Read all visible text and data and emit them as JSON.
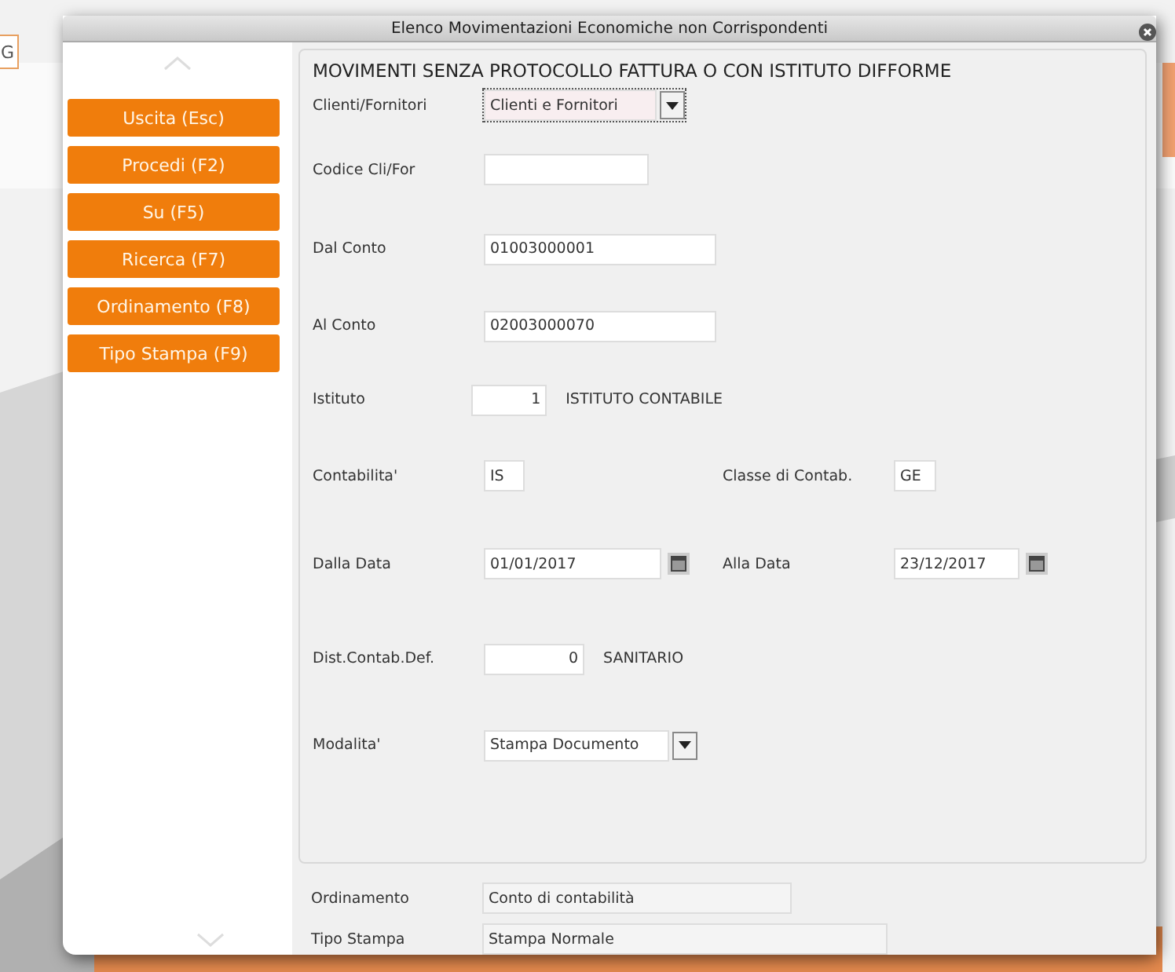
{
  "background_page": {
    "button_text": "G"
  },
  "window": {
    "title": "Elenco Movimentazioni Economiche non Corrispondenti"
  },
  "sidebar": {
    "buttons": [
      {
        "label": "Uscita (Esc)"
      },
      {
        "label": "Procedi (F2)"
      },
      {
        "label": "Su (F5)"
      },
      {
        "label": "Ricerca (F7)"
      },
      {
        "label": "Ordinamento (F8)"
      },
      {
        "label": "Tipo Stampa (F9)"
      }
    ]
  },
  "form": {
    "title": "MOVIMENTI SENZA PROTOCOLLO FATTURA O CON ISTITUTO DIFFORME",
    "rows": [
      {
        "fields": [
          {
            "label": "Clienti/Fornitori",
            "kind": "select",
            "value": "Clienti e Fornitori",
            "focused": true
          }
        ]
      },
      {
        "fields": [
          {
            "label": "Codice Cli/For",
            "kind": "text"
          }
        ]
      },
      {
        "fields": [
          {
            "label": "Dal Conto",
            "kind": "text",
            "value": "01003000001"
          }
        ]
      },
      {
        "fields": [
          {
            "label": "Al Conto",
            "kind": "text",
            "value": "02003000070"
          }
        ]
      },
      {
        "fields": [
          {
            "label": "Istituto",
            "kind": "number",
            "value": "1",
            "note": "ISTITUTO CONTABILE"
          }
        ]
      },
      {
        "fields": [
          {
            "label": "Contabilita'",
            "kind": "text",
            "value": "IS"
          },
          {
            "label": "Classe di Contab.",
            "kind": "text",
            "value": "GE"
          }
        ]
      },
      {
        "fields": [
          {
            "label": "Dalla Data",
            "kind": "date",
            "value": "01/01/2017"
          },
          {
            "label": "Alla Data",
            "kind": "date",
            "value": "23/12/2017"
          }
        ]
      },
      {
        "fields": [
          {
            "label": "Dist.Contab.Def.",
            "kind": "number",
            "value": "0",
            "note": "SANITARIO"
          }
        ]
      },
      {
        "fields": [
          {
            "label": "Modalita'",
            "kind": "select",
            "value": "Stampa Documento",
            "focused": false
          }
        ]
      }
    ]
  },
  "summary": [
    {
      "label": "Ordinamento",
      "value": "Conto di contabilità"
    },
    {
      "label": "Tipo Stampa",
      "value": "Stampa Normale"
    }
  ]
}
